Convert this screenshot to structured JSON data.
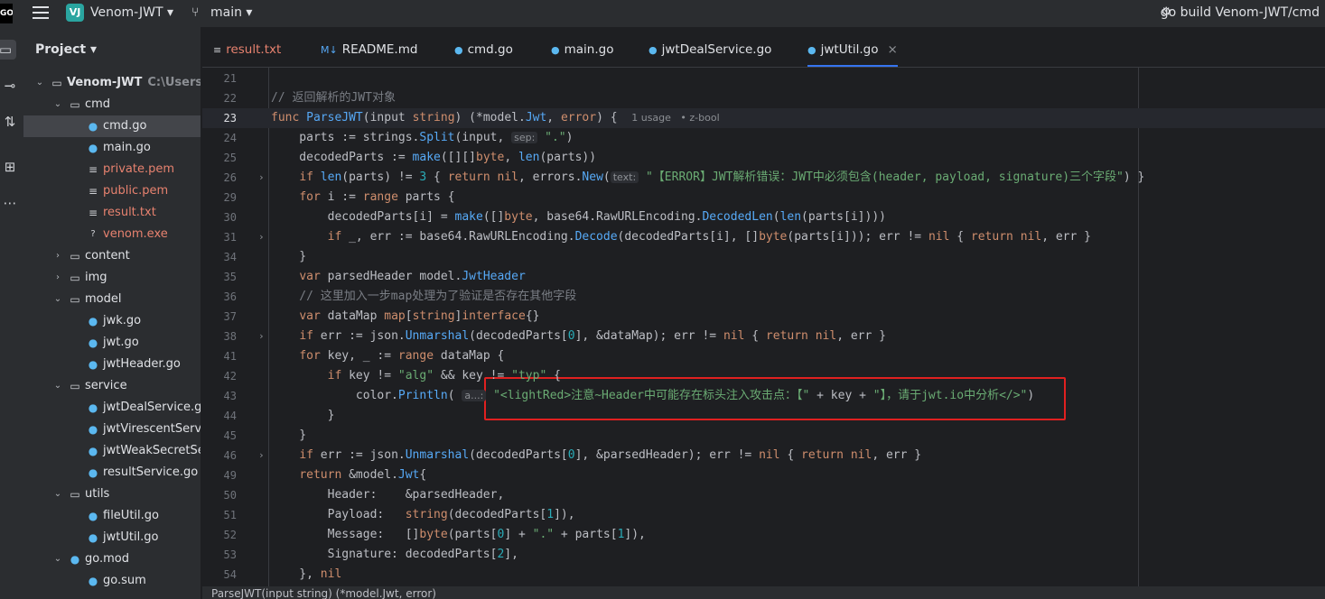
{
  "topbar": {
    "logo": "GO",
    "project_badge": "VJ",
    "project_name": "Venom-JWT",
    "branch": "main",
    "run_config": "go build Venom-JWT/cmd"
  },
  "sidebar": {
    "title": "Project",
    "tree": [
      {
        "label": "Venom-JWT",
        "path": "C:\\Users\\",
        "icon": "folder",
        "depth": 0,
        "arrow": "down",
        "bold": true
      },
      {
        "label": "cmd",
        "icon": "folder",
        "depth": 1,
        "arrow": "down"
      },
      {
        "label": "cmd.go",
        "icon": "go",
        "depth": 2,
        "selected": true
      },
      {
        "label": "main.go",
        "icon": "go",
        "depth": 2
      },
      {
        "label": "private.pem",
        "icon": "txt",
        "depth": 2,
        "red": true
      },
      {
        "label": "public.pem",
        "icon": "txt",
        "depth": 2,
        "red": true
      },
      {
        "label": "result.txt",
        "icon": "txt",
        "depth": 2,
        "red": true
      },
      {
        "label": "venom.exe",
        "icon": "exe",
        "depth": 2,
        "red": true
      },
      {
        "label": "content",
        "icon": "folder",
        "depth": 1,
        "arrow": "right"
      },
      {
        "label": "img",
        "icon": "folder",
        "depth": 1,
        "arrow": "right"
      },
      {
        "label": "model",
        "icon": "folder",
        "depth": 1,
        "arrow": "down"
      },
      {
        "label": "jwk.go",
        "icon": "go",
        "depth": 2
      },
      {
        "label": "jwt.go",
        "icon": "go",
        "depth": 2
      },
      {
        "label": "jwtHeader.go",
        "icon": "go",
        "depth": 2
      },
      {
        "label": "service",
        "icon": "folder",
        "depth": 1,
        "arrow": "down"
      },
      {
        "label": "jwtDealService.go",
        "icon": "go",
        "depth": 2
      },
      {
        "label": "jwtVirescentService.go",
        "icon": "go",
        "depth": 2
      },
      {
        "label": "jwtWeakSecretService.go",
        "icon": "go",
        "depth": 2
      },
      {
        "label": "resultService.go",
        "icon": "go",
        "depth": 2
      },
      {
        "label": "utils",
        "icon": "folder",
        "depth": 1,
        "arrow": "down"
      },
      {
        "label": "fileUtil.go",
        "icon": "go",
        "depth": 2
      },
      {
        "label": "jwtUtil.go",
        "icon": "go",
        "depth": 2
      },
      {
        "label": "go.mod",
        "icon": "gomod",
        "depth": 1,
        "arrow": "down"
      },
      {
        "label": "go.sum",
        "icon": "gomod",
        "depth": 2
      }
    ]
  },
  "tabs": [
    {
      "label": "result.txt",
      "icon": "txt",
      "red": true
    },
    {
      "label": "README.md",
      "icon": "md"
    },
    {
      "label": "cmd.go",
      "icon": "go"
    },
    {
      "label": "main.go",
      "icon": "go"
    },
    {
      "label": "jwtDealService.go",
      "icon": "go"
    },
    {
      "label": "jwtUtil.go",
      "icon": "go",
      "active": true,
      "close": "×"
    }
  ],
  "code": [
    {
      "n": "21",
      "t": []
    },
    {
      "n": "22",
      "t": [
        [
          "// 返回解析的JWT对象",
          "cm"
        ]
      ]
    },
    {
      "n": "23",
      "cur": true,
      "t": [
        [
          "func ",
          "kw"
        ],
        [
          "ParseJWT",
          "fn"
        ],
        [
          "(input ",
          "tx"
        ],
        [
          "string",
          "kw"
        ],
        [
          ") (*",
          "tx"
        ],
        [
          "model",
          "tx"
        ],
        [
          ".",
          "tx"
        ],
        [
          "Jwt",
          "ty"
        ],
        [
          ", ",
          "tx"
        ],
        [
          "error",
          "kw"
        ],
        [
          ") {  ",
          "tx"
        ],
        [
          "1 usage   ",
          "hint"
        ],
        [
          "• z-bool",
          "hint"
        ]
      ]
    },
    {
      "n": "24",
      "t": [
        [
          "    parts := ",
          "tx"
        ],
        [
          "strings",
          "tx"
        ],
        [
          ".",
          "tx"
        ],
        [
          "Split",
          "fn2"
        ],
        [
          "(input, ",
          "tx"
        ],
        [
          "sep:",
          "inlay"
        ],
        [
          " ",
          "tx"
        ],
        [
          "\".\"",
          "str"
        ],
        [
          ")",
          "tx"
        ]
      ]
    },
    {
      "n": "25",
      "t": [
        [
          "    decodedParts := ",
          "tx"
        ],
        [
          "make",
          "fn2"
        ],
        [
          "([][]",
          "tx"
        ],
        [
          "byte",
          "kw"
        ],
        [
          ", ",
          "tx"
        ],
        [
          "len",
          "fn2"
        ],
        [
          "(parts))",
          "tx"
        ]
      ]
    },
    {
      "n": "26",
      "fold": true,
      "t": [
        [
          "    ",
          "tx"
        ],
        [
          "if ",
          "kw"
        ],
        [
          "len",
          "fn2"
        ],
        [
          "(parts) != ",
          "tx"
        ],
        [
          "3",
          "num"
        ],
        [
          " { ",
          "tx"
        ],
        [
          "return nil",
          "kw"
        ],
        [
          ", errors.",
          "tx"
        ],
        [
          "New",
          "fn2"
        ],
        [
          "(",
          "tx"
        ],
        [
          "text:",
          "inlay"
        ],
        [
          " ",
          "tx"
        ],
        [
          "\"【ERROR】JWT解析错误：JWT中必须包含(header, payload, signature)三个字段\"",
          "str"
        ],
        [
          ") }",
          "tx"
        ]
      ]
    },
    {
      "n": "29",
      "t": [
        [
          "    ",
          "tx"
        ],
        [
          "for ",
          "kw"
        ],
        [
          "i := ",
          "tx"
        ],
        [
          "range ",
          "kw"
        ],
        [
          "parts {",
          "tx"
        ]
      ]
    },
    {
      "n": "30",
      "t": [
        [
          "        decodedParts[i] = ",
          "tx"
        ],
        [
          "make",
          "fn2"
        ],
        [
          "([]",
          "tx"
        ],
        [
          "byte",
          "kw"
        ],
        [
          ", base64.RawURLEncoding.",
          "tx"
        ],
        [
          "DecodedLen",
          "fn2"
        ],
        [
          "(",
          "tx"
        ],
        [
          "len",
          "fn2"
        ],
        [
          "(parts[i])))",
          "tx"
        ]
      ]
    },
    {
      "n": "31",
      "fold": true,
      "t": [
        [
          "        ",
          "tx"
        ],
        [
          "if ",
          "kw"
        ],
        [
          "_, err := base64.RawURLEncoding.",
          "tx"
        ],
        [
          "Decode",
          "fn2"
        ],
        [
          "(decodedParts[i], []",
          "tx"
        ],
        [
          "byte",
          "kw"
        ],
        [
          "(parts[i])); err != ",
          "tx"
        ],
        [
          "nil",
          "kw"
        ],
        [
          " { ",
          "tx"
        ],
        [
          "return nil",
          "kw"
        ],
        [
          ", err }",
          "tx"
        ]
      ]
    },
    {
      "n": "34",
      "t": [
        [
          "    }",
          "tx"
        ]
      ]
    },
    {
      "n": "35",
      "t": [
        [
          "    ",
          "tx"
        ],
        [
          "var ",
          "kw"
        ],
        [
          "parsedHeader model.",
          "tx"
        ],
        [
          "JwtHeader",
          "ty"
        ]
      ]
    },
    {
      "n": "36",
      "t": [
        [
          "    // 这里加入一步map处理为了验证是否存在其他字段",
          "cm"
        ]
      ]
    },
    {
      "n": "37",
      "t": [
        [
          "    ",
          "tx"
        ],
        [
          "var ",
          "kw"
        ],
        [
          "dataMap ",
          "tx"
        ],
        [
          "map",
          "kw"
        ],
        [
          "[",
          "tx"
        ],
        [
          "string",
          "kw"
        ],
        [
          "]",
          "tx"
        ],
        [
          "interface",
          "kw"
        ],
        [
          "{}",
          "tx"
        ]
      ]
    },
    {
      "n": "38",
      "fold": true,
      "t": [
        [
          "    ",
          "tx"
        ],
        [
          "if ",
          "kw"
        ],
        [
          "err := json.",
          "tx"
        ],
        [
          "Unmarshal",
          "fn2"
        ],
        [
          "(decodedParts[",
          "tx"
        ],
        [
          "0",
          "num"
        ],
        [
          "], &dataMap); err != ",
          "tx"
        ],
        [
          "nil",
          "kw"
        ],
        [
          " { ",
          "tx"
        ],
        [
          "return nil",
          "kw"
        ],
        [
          ", err }",
          "tx"
        ]
      ]
    },
    {
      "n": "41",
      "t": [
        [
          "    ",
          "tx"
        ],
        [
          "for ",
          "kw"
        ],
        [
          "key, _ := ",
          "tx"
        ],
        [
          "range ",
          "kw"
        ],
        [
          "dataMap {",
          "tx"
        ]
      ]
    },
    {
      "n": "42",
      "t": [
        [
          "        ",
          "tx"
        ],
        [
          "if ",
          "kw"
        ],
        [
          "key != ",
          "tx"
        ],
        [
          "\"alg\"",
          "str"
        ],
        [
          " && key != ",
          "tx"
        ],
        [
          "\"typ\"",
          "str"
        ],
        [
          " {",
          "tx"
        ]
      ]
    },
    {
      "n": "43",
      "t": [
        [
          "            color.",
          "tx"
        ],
        [
          "Println",
          "fn2"
        ],
        [
          "( ",
          "tx"
        ],
        [
          "a...:",
          "inlay"
        ],
        [
          " ",
          "tx"
        ],
        [
          "\"<lightRed>注意~Header中可能存在标头注入攻击点：【\"",
          "str"
        ],
        [
          " + key + ",
          "tx"
        ],
        [
          "\"】，请于jwt.io中分析</>\"",
          "str"
        ],
        [
          ")",
          "tx"
        ]
      ]
    },
    {
      "n": "44",
      "t": [
        [
          "        }",
          "tx"
        ]
      ]
    },
    {
      "n": "45",
      "t": [
        [
          "    }",
          "tx"
        ]
      ]
    },
    {
      "n": "46",
      "fold": true,
      "t": [
        [
          "    ",
          "tx"
        ],
        [
          "if ",
          "kw"
        ],
        [
          "err := json.",
          "tx"
        ],
        [
          "Unmarshal",
          "fn2"
        ],
        [
          "(decodedParts[",
          "tx"
        ],
        [
          "0",
          "num"
        ],
        [
          "], &parsedHeader); err != ",
          "tx"
        ],
        [
          "nil",
          "kw"
        ],
        [
          " { ",
          "tx"
        ],
        [
          "return nil",
          "kw"
        ],
        [
          ", err }",
          "tx"
        ]
      ]
    },
    {
      "n": "49",
      "t": [
        [
          "    ",
          "tx"
        ],
        [
          "return ",
          "kw"
        ],
        [
          "&model.",
          "tx"
        ],
        [
          "Jwt",
          "ty"
        ],
        [
          "{",
          "tx"
        ]
      ]
    },
    {
      "n": "50",
      "t": [
        [
          "        Header:    &parsedHeader,",
          "tx"
        ]
      ]
    },
    {
      "n": "51",
      "t": [
        [
          "        Payload:   ",
          "tx"
        ],
        [
          "string",
          "kw"
        ],
        [
          "(decodedParts[",
          "tx"
        ],
        [
          "1",
          "num"
        ],
        [
          "]),",
          "tx"
        ]
      ]
    },
    {
      "n": "52",
      "t": [
        [
          "        Message:   []",
          "tx"
        ],
        [
          "byte",
          "kw"
        ],
        [
          "(parts[",
          "tx"
        ],
        [
          "0",
          "num"
        ],
        [
          "] + ",
          "tx"
        ],
        [
          "\".\"",
          "str"
        ],
        [
          " + parts[",
          "tx"
        ],
        [
          "1",
          "num"
        ],
        [
          "]),",
          "tx"
        ]
      ]
    },
    {
      "n": "53",
      "t": [
        [
          "        Signature: decodedParts[",
          "tx"
        ],
        [
          "2",
          "num"
        ],
        [
          "],",
          "tx"
        ]
      ]
    },
    {
      "n": "54",
      "t": [
        [
          "    }, ",
          "tx"
        ],
        [
          "nil",
          "kw"
        ]
      ]
    }
  ],
  "status": {
    "text": "ParseJWT(input string) (*model.Jwt, error)"
  },
  "colors": {
    "kw": "#cf8e6d",
    "fn": "#56a8f5",
    "fn2": "#57aaf7",
    "str": "#6aab73",
    "cm": "#7a7e85",
    "num": "#2aacb8",
    "ty": "#56a8f5",
    "tx": "#bcbec4",
    "hint": "#8c8f94",
    "inlay": "#8c8f94",
    "highlight": "#e02020",
    "accent": "#3574f0"
  }
}
